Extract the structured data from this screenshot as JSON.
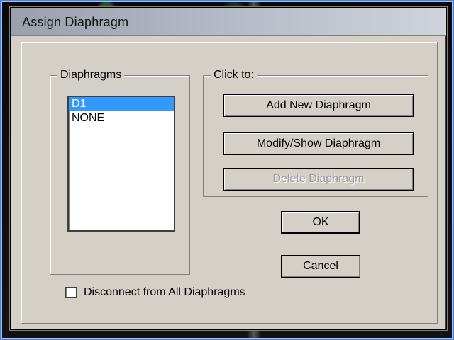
{
  "dialog": {
    "title": "Assign Diaphragm"
  },
  "diaphragms_group": {
    "title": "Diaphragms",
    "items": [
      {
        "label": "D1",
        "selected": true
      },
      {
        "label": "NONE",
        "selected": false
      }
    ]
  },
  "click_to_group": {
    "title": "Click to:",
    "buttons": {
      "add": "Add New Diaphragm",
      "modify": "Modify/Show Diaphragm",
      "delete": "Delete Diaphragm"
    }
  },
  "actions": {
    "ok": "OK",
    "cancel": "Cancel"
  },
  "options": {
    "disconnect_all": {
      "label": "Disconnect from All Diaphragms",
      "checked": false
    }
  },
  "colors": {
    "dialog_bg": "#d4d0c8",
    "selection": "#3399ff",
    "shot_border": "#4c7fd0"
  },
  "icons": {
    "checkbox": "checkbox-icon"
  }
}
